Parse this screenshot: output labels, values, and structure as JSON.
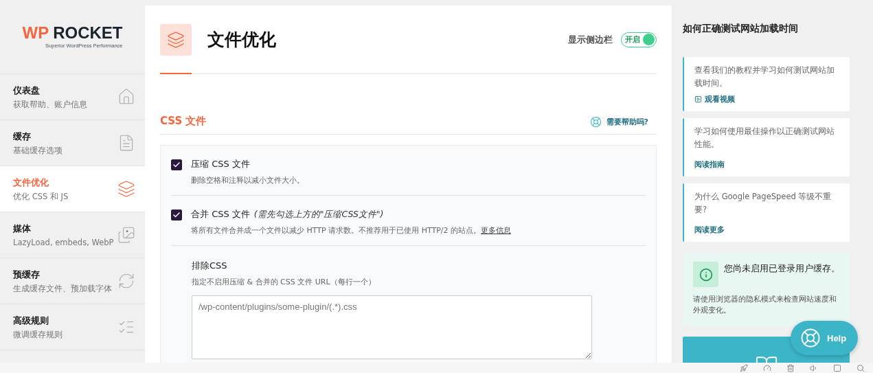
{
  "logo": {
    "prefix": "WP",
    "name": "ROCKET",
    "tagline": "Superior WordPress Performance"
  },
  "sidebar": {
    "items": [
      {
        "title": "仪表盘",
        "subtitle": "获取帮助、账户信息",
        "selected": false
      },
      {
        "title": "缓存",
        "subtitle": "基础缓存选项",
        "selected": false
      },
      {
        "title": "文件优化",
        "subtitle": "优化 CSS 和 JS",
        "selected": true
      },
      {
        "title": "媒体",
        "subtitle": "LazyLoad, embeds, WebP",
        "selected": false
      },
      {
        "title": "预缓存",
        "subtitle": "生成缓存文件、预加载字体",
        "selected": false
      },
      {
        "title": "高级规则",
        "subtitle": "微调缓存规则",
        "selected": false
      }
    ]
  },
  "header": {
    "title": "文件优化",
    "sidebar_toggle": {
      "label": "显示侧边栏",
      "state_text": "开启",
      "on": true
    }
  },
  "section": {
    "title": "CSS 文件",
    "help_link": "需要帮助吗?"
  },
  "options": [
    {
      "kind": "checkbox",
      "label": "压缩 CSS 文件",
      "description": "删除空格和注释以减小文件大小。",
      "checked": true
    },
    {
      "kind": "checkbox",
      "label": "合并 CSS 文件",
      "note": "(需先勾选上方的\"压缩CSS文件\")",
      "description": "将所有文件合并成一个文件以减少 HTTP 请求数。不推荐用于已使用 HTTP/2 的站点。",
      "link": "更多信息",
      "checked": true
    },
    {
      "kind": "textarea",
      "label": "排除CSS",
      "description": "指定不启用压缩 & 合并的 CSS 文件 URL（每行一个）",
      "placeholder": "/wp-content/plugins/some-plugin/(.*).css"
    }
  ],
  "right_panel": {
    "title": "如何正确测试网站加载时间",
    "cards": [
      {
        "text": "查看我们的教程并学习如何测试网站加载时间。",
        "link": "观看视频",
        "kind": "video"
      },
      {
        "text": "学习如何使用最佳操作以正确测试网站性能。",
        "link": "阅读指南",
        "kind": "plain"
      },
      {
        "text": "为什么 Google PageSpeed 等级不重要?",
        "link": "阅读更多",
        "kind": "plain"
      }
    ],
    "notice": {
      "title": "您尚未启用已登录用户缓存。",
      "text": "请使用浏览器的隐私模式来检查网站速度和外观变化。"
    },
    "help_button": "Help"
  }
}
